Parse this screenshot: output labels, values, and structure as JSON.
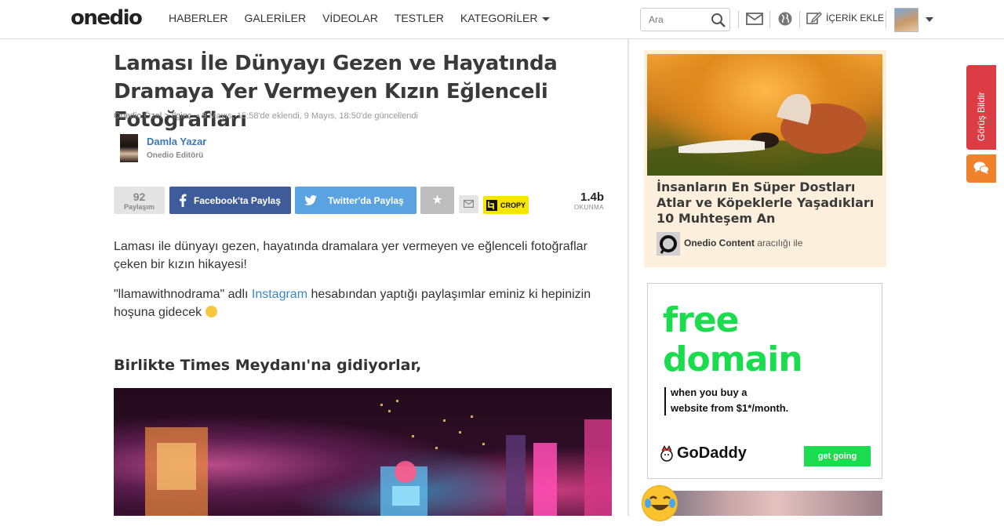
{
  "header": {
    "logo": "onedio",
    "nav": [
      "HABERLER",
      "GALERİLER",
      "VİDEOLAR",
      "TESTLER",
      "KATEGORİLER"
    ],
    "search_placeholder": "Ara",
    "add_content_label": "İÇERİK EKLE"
  },
  "article": {
    "title": "Laması İle Dünyayı Gezen ve Hayatında Dramaya Yer Vermeyen Kızın Eğlenceli Fotoğrafları",
    "breadcrumb": "Onedio Özel > İlginç",
    "dates": "• 9 Mayıs, 15:58'de eklendi, 9 Mayıs, 18:50'de güncellendi",
    "author_name": "Damla Yazar",
    "author_role": "Onedio Editörü",
    "share_count": "92",
    "share_label": "Paylaşım",
    "facebook_label": "Facebook'ta Paylaş",
    "twitter_label": "Twitter'da Paylaş",
    "cropy_label": "CROPY",
    "views_count": "1.4b",
    "views_label": "OKUNMA",
    "paragraph1": "Laması ile dünyayı gezen, hayatında dramalara yer vermeyen ve eğlenceli fotoğraflar çeken bir kızın hikayesi!",
    "paragraph2_before": "\"llamawithnodrama\" adlı ",
    "paragraph2_link": "Instagram",
    "paragraph2_after": " hesabından yaptığı paylaşımlar eminiz ki hepinizin hoşuna gidecek",
    "subheading": "Birlikte Times Meydanı'na gidiyorlar,"
  },
  "sidebar": {
    "promo_title": "İnsanların En Süper Dostları Atlar ve Köpeklerle Yaşadıkları 10 Muhteşem An",
    "promo_source": "Onedio Content",
    "promo_source_suffix": "aracılığı ile",
    "ad_line1": "free",
    "ad_line2": "domain",
    "ad_sub1": "when you buy a",
    "ad_sub2": "website from $1*/month.",
    "ad_brand": "GoDaddy",
    "ad_cta": "get going"
  },
  "feedback_label": "Görüş Bildir",
  "colors": {
    "facebook": "#3e5c9a",
    "twitter": "#5ba3e0",
    "feedback": "#dc3d45",
    "chat": "#f0822c",
    "ad_green": "#1bdb4e",
    "link": "#3b88c6"
  }
}
